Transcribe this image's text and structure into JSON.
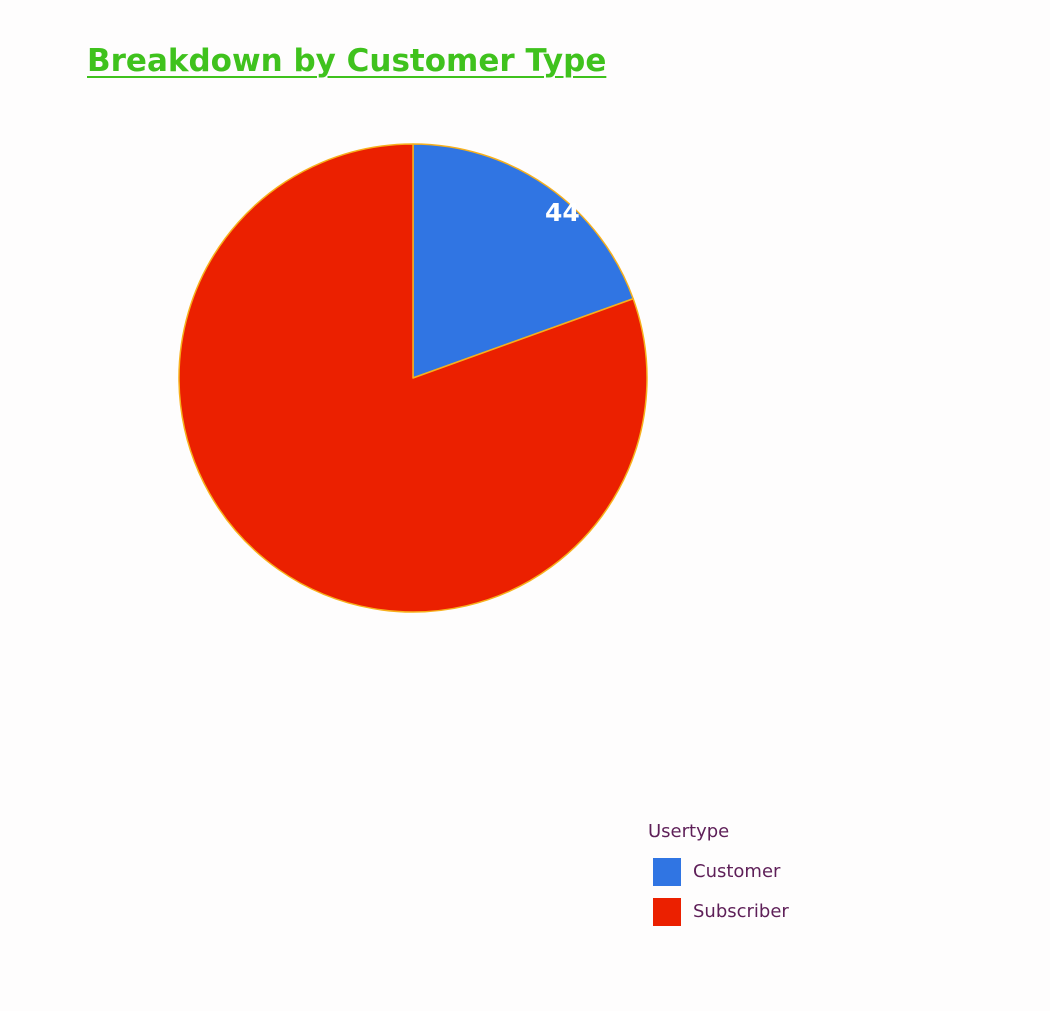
{
  "chart_data": {
    "type": "pie",
    "title": "Breakdown by Customer Type",
    "legend_title": "Usertype",
    "legend_position": "bottom-right",
    "slice_label": "44",
    "slices": [
      {
        "label": "Customer",
        "value": 19.5,
        "color": "#3075e3"
      },
      {
        "label": "Subscriber",
        "value": 80.5,
        "color": "#eb2000"
      }
    ],
    "slice_edge_color": "#f7b01c"
  }
}
